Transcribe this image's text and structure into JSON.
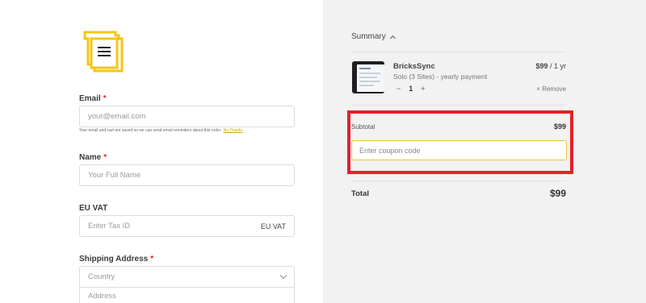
{
  "form": {
    "email": {
      "label": "Email",
      "required": "*",
      "placeholder": "your@email.com",
      "hint": "Your email and cart are saved so we can send email reminders about this order.",
      "hint_link": "No Thanks"
    },
    "name": {
      "label": "Name",
      "required": "*",
      "placeholder": "Your Full Name"
    },
    "vat": {
      "label": "EU VAT",
      "placeholder": "Enter Tax ID",
      "suffix": "EU VAT"
    },
    "shipping": {
      "label": "Shipping Address",
      "required": "*",
      "country_placeholder": "Country",
      "address_placeholder": "Address"
    }
  },
  "summary": {
    "title": "Summary",
    "product": {
      "name": "BricksSync",
      "description": "Solo (3 Sites) - yearly payment",
      "price": "$99",
      "period": "/ 1 yr",
      "quantity": "1",
      "minus": "−",
      "plus": "+",
      "remove_label": "Remove",
      "remove_icon": "×"
    },
    "subtotal_label": "Subtotal",
    "subtotal_value": "$99",
    "coupon_placeholder": "Enter coupon code",
    "total_label": "Total",
    "total_value": "$99"
  },
  "colors": {
    "brand_yellow": "#f5c518",
    "highlight_red": "#e5202a",
    "right_bg": "#f2f2f3"
  }
}
